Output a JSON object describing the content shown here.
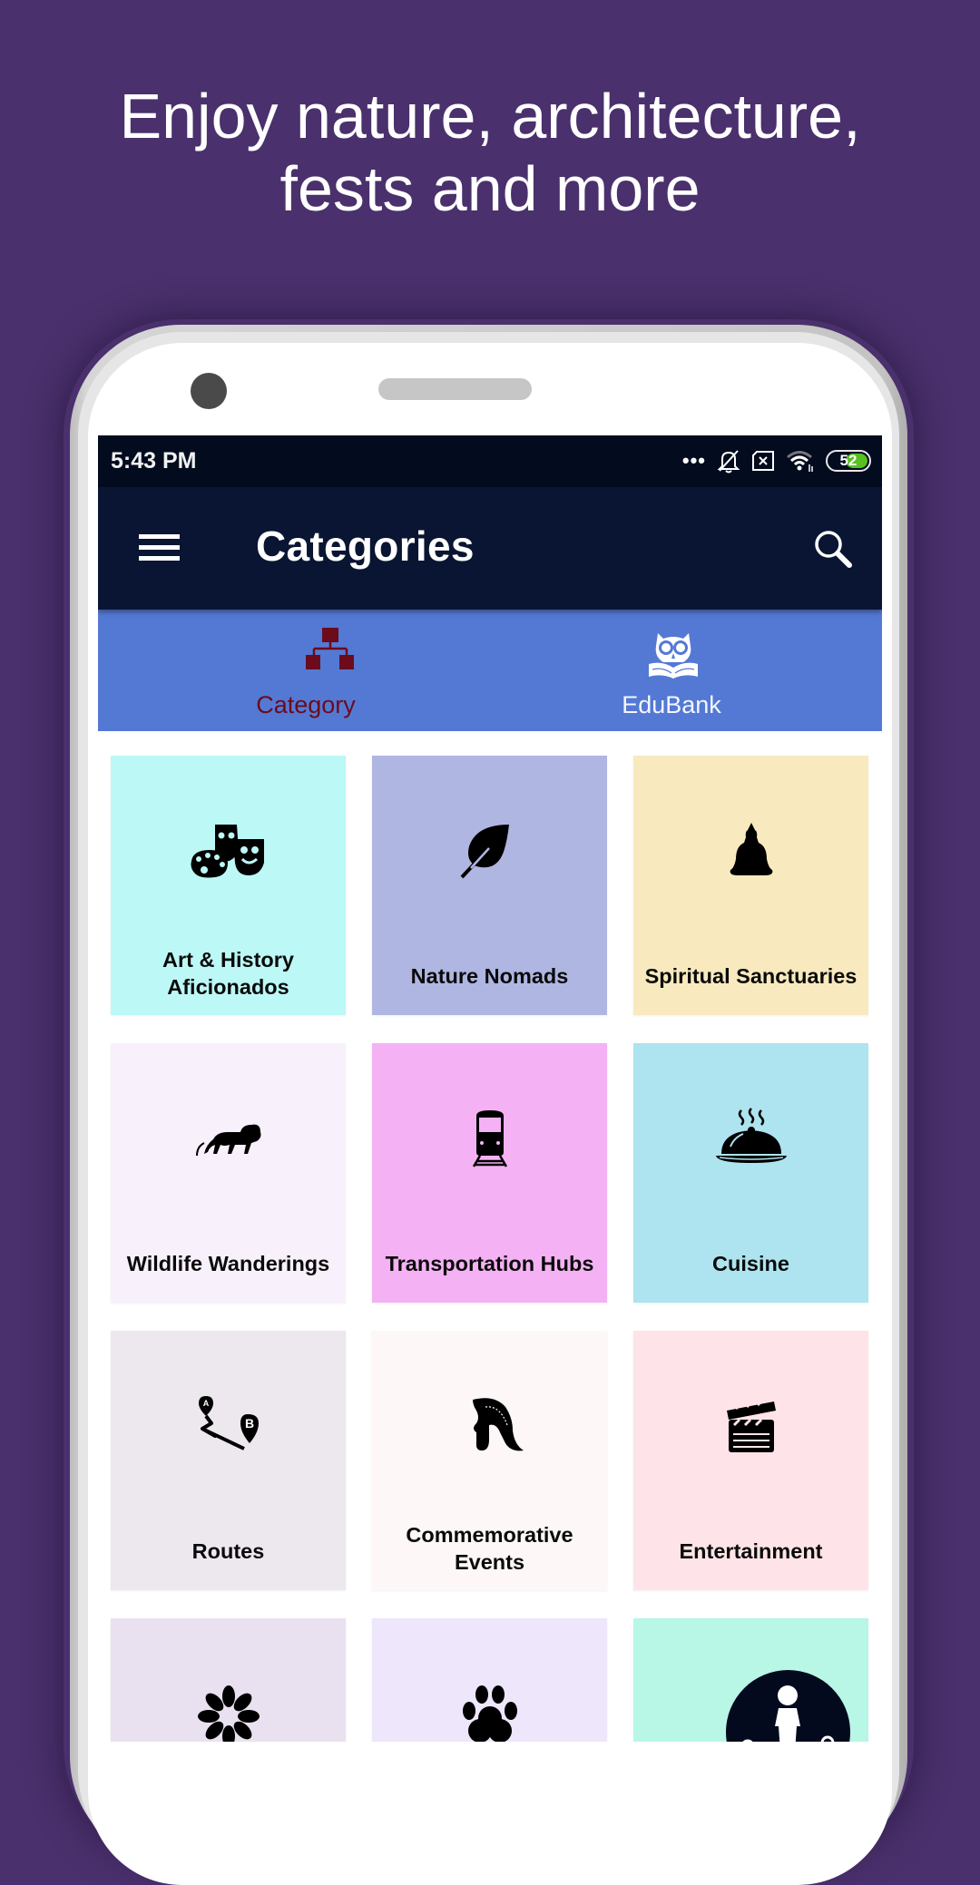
{
  "promo": {
    "headline_line1": "Enjoy nature, architecture,",
    "headline_line2": "fests and more",
    "background_color": "#4a306c"
  },
  "status_bar": {
    "time": "5:43 PM",
    "icons": [
      "more-dots-icon",
      "notifications-off-icon",
      "sim-off-icon",
      "wifi-icon",
      "battery-icon"
    ],
    "battery_level": "52"
  },
  "app_bar": {
    "title": "Categories",
    "menu_icon": "hamburger-menu-icon",
    "search_icon": "search-icon",
    "background_color": "#0a1533"
  },
  "tabs": [
    {
      "label": "Category",
      "icon": "hierarchy-icon",
      "active": true,
      "color": "#6b0b1b"
    },
    {
      "label": "EduBank",
      "icon": "owl-book-icon",
      "active": false,
      "color": "#ffffff"
    }
  ],
  "tab_bar_color": "#5479d4",
  "categories": [
    {
      "label": "Art & History Aficionados",
      "icon": "art-theatre-icon",
      "color": "#bcf8f6"
    },
    {
      "label": "Nature Nomads",
      "icon": "leaf-icon",
      "color": "#b0b6e2"
    },
    {
      "label": "Spiritual Sanctuaries",
      "icon": "buddha-icon",
      "color": "#f8eabe"
    },
    {
      "label": "Wildlife Wanderings",
      "icon": "lion-icon",
      "color": "#f8f0fa"
    },
    {
      "label": "Transportation Hubs",
      "icon": "train-icon",
      "color": "#f4b2f4"
    },
    {
      "label": "Cuisine",
      "icon": "food-cloche-icon",
      "color": "#ade4ef"
    },
    {
      "label": "Routes",
      "icon": "route-icon",
      "color": "#ece8ee"
    },
    {
      "label": "Commemorative Events",
      "icon": "spartan-helmet-icon",
      "color": "#fdf7f7"
    },
    {
      "label": "Entertainment",
      "icon": "clapperboard-icon",
      "color": "#fee4e8"
    },
    {
      "label": "",
      "icon": "flower-icon",
      "color": "#e9e1ef"
    },
    {
      "label": "",
      "icon": "paw-icon",
      "color": "#eee6fa"
    },
    {
      "label": "",
      "icon": "traveler-pins-icon",
      "color": "#b8f6e6"
    }
  ]
}
